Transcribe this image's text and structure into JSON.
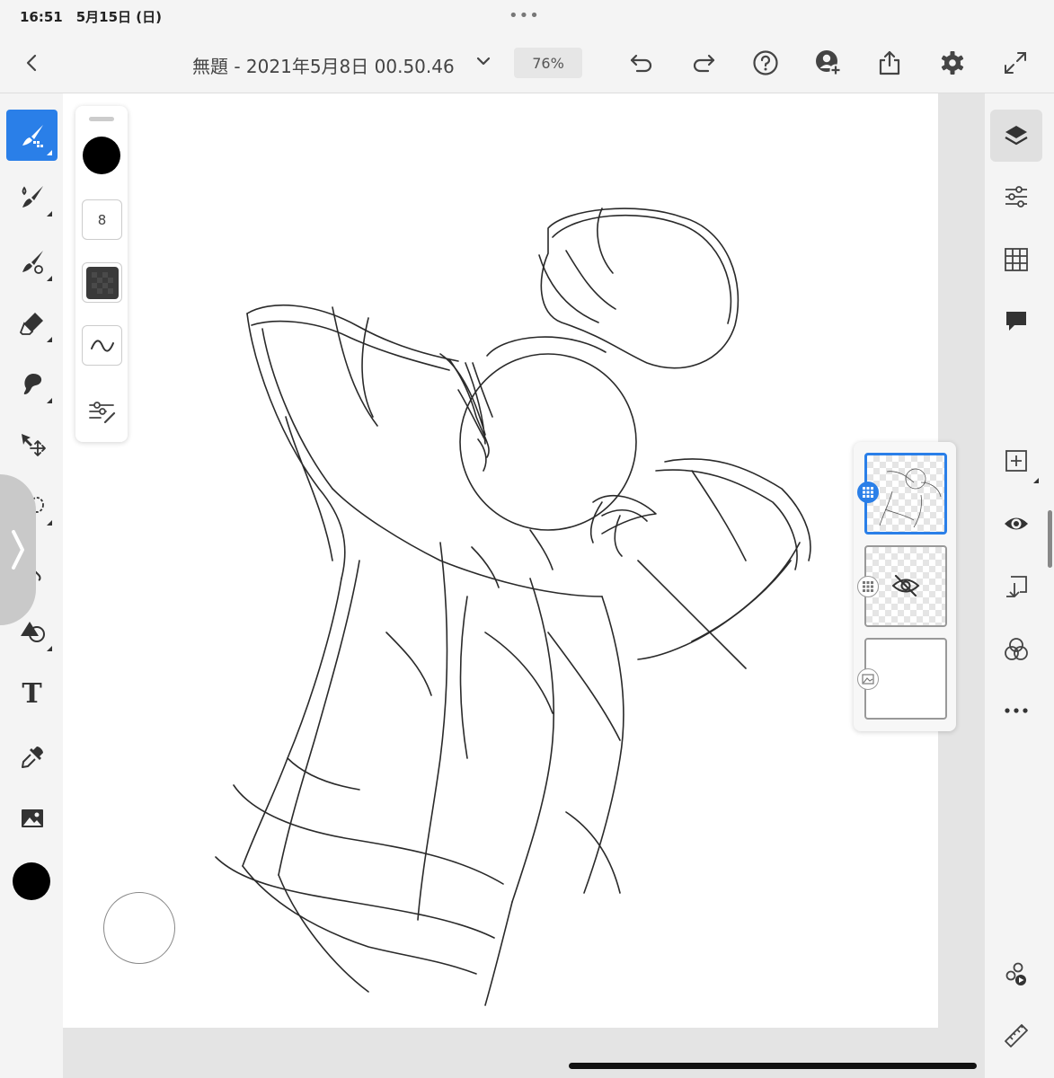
{
  "status_bar": {
    "time_date": "16:51　5月15日 (日)",
    "multitask": "•••"
  },
  "toolbar": {
    "back_icon": "chevron-left-icon",
    "document_title": "無題 - 2021年5月8日 00.50.46",
    "zoom": "76%",
    "icons": [
      "undo-icon",
      "redo-icon",
      "help-icon",
      "invite-user-icon",
      "share-icon",
      "settings-icon",
      "fullscreen-icon"
    ]
  },
  "left_tools": [
    {
      "name": "pixel-brush",
      "icon": "pixel-brush-icon",
      "active": true
    },
    {
      "name": "live-brush",
      "icon": "live-brush-icon"
    },
    {
      "name": "vector-brush",
      "icon": "vector-brush-icon"
    },
    {
      "name": "eraser",
      "icon": "eraser-icon"
    },
    {
      "name": "smudge",
      "icon": "smudge-icon"
    },
    {
      "name": "transform",
      "icon": "move-icon"
    },
    {
      "name": "selection",
      "icon": "lasso-icon"
    },
    {
      "name": "fill",
      "icon": "fill-icon"
    },
    {
      "name": "shapes",
      "icon": "shapes-icon"
    },
    {
      "name": "text",
      "icon": "text-icon",
      "label": "T"
    },
    {
      "name": "eyedropper",
      "icon": "eyedropper-icon"
    },
    {
      "name": "image",
      "icon": "image-icon"
    }
  ],
  "current_color": "#000000",
  "tool_properties": {
    "color": "#000000",
    "brush_size": "8",
    "opacity_icon": "opacity-icon",
    "flow_icon": "pressure-curve-icon",
    "settings_icon": "brush-settings-icon"
  },
  "layers": [
    {
      "name": "sketch-layer",
      "selected": true,
      "visible": true
    },
    {
      "name": "hidden-layer",
      "selected": false,
      "visible": false
    },
    {
      "name": "background-layer",
      "selected": false,
      "visible": true
    }
  ],
  "right_tools": [
    "layers-icon",
    "adjustments-icon",
    "grid-icon",
    "comment-icon",
    "add-layer-icon",
    "visibility-icon",
    "merge-down-icon",
    "blend-mode-icon",
    "more-icon",
    "livestream-icon",
    "ruler-icon"
  ]
}
